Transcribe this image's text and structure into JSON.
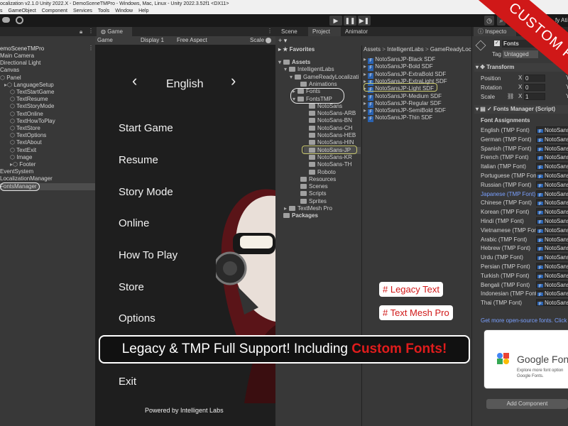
{
  "window": {
    "title": "ocalization v2.1.0 Unity 2022.X - DemoSceneTMPro - Windows, Mac, Linux - Unity 2022.3.52f1 <DX11>"
  },
  "menu": [
    "s",
    "GameObject",
    "Component",
    "Services",
    "Tools",
    "Window",
    "Help"
  ],
  "toolbar": {
    "account": "fy Ati"
  },
  "hierarchy": {
    "root": "emoSceneTMPro",
    "items": [
      {
        "label": "Main Camera"
      },
      {
        "label": "Directional Light"
      },
      {
        "label": "Canvas"
      },
      {
        "label": "Panel"
      },
      {
        "label": "LanguageSetup"
      },
      {
        "label": "TextStartGame"
      },
      {
        "label": "TextResume"
      },
      {
        "label": "TextStoryMode"
      },
      {
        "label": "TextOnline"
      },
      {
        "label": "TextHowToPlay"
      },
      {
        "label": "TextStore"
      },
      {
        "label": "TextOptions"
      },
      {
        "label": "TextAbout"
      },
      {
        "label": "TextExit"
      },
      {
        "label": "Image"
      },
      {
        "label": "Footer"
      },
      {
        "label": "EventSystem"
      },
      {
        "label": "LocalizationManager"
      },
      {
        "label": "FontsManager"
      }
    ]
  },
  "game": {
    "tab": "Game",
    "view_dropdown": "Game",
    "display": "Display 1",
    "aspect": "Free Aspect",
    "scale_label": "Scale",
    "language": "English",
    "prev": "‹",
    "next": "›",
    "menu_items": [
      "Start Game",
      "Resume",
      "Story Mode",
      "Online",
      "How To Play",
      "Store",
      "Options",
      "Exit"
    ],
    "footer": "Powered by Intelligent Labs"
  },
  "scene_tabs": {
    "scene": "Scene",
    "project": "Project",
    "animator": "Animator"
  },
  "project": {
    "favorites": "Favorites",
    "breadcrumb": [
      "Assets",
      "IntelligentLabs",
      "GameReadyLoc"
    ],
    "tree": [
      {
        "label": "Assets"
      },
      {
        "label": "IntelligentLabs"
      },
      {
        "label": "GameReadyLocalizati"
      },
      {
        "label": "Animations"
      },
      {
        "label": "Fonts"
      },
      {
        "label": "FontsTMP"
      },
      {
        "label": "NotoSans"
      },
      {
        "label": "NotoSans-ARB"
      },
      {
        "label": "NotoSans-BN"
      },
      {
        "label": "NotoSans-CH"
      },
      {
        "label": "NotoSans-HEB"
      },
      {
        "label": "NotoSans-HIN"
      },
      {
        "label": "NotoSans-JP"
      },
      {
        "label": "NotoSans-KR"
      },
      {
        "label": "NotoSans-TH"
      },
      {
        "label": "Roboto"
      },
      {
        "label": "Resources"
      },
      {
        "label": "Scenes"
      },
      {
        "label": "Scripts"
      },
      {
        "label": "Sprites"
      },
      {
        "label": "TextMesh Pro"
      },
      {
        "label": "Packages"
      }
    ],
    "files": [
      "NotoSansJP-Black SDF",
      "NotoSansJP-Bold SDF",
      "NotoSansJP-ExtraBold SDF",
      "NotoSansJP-ExtraLight SDF",
      "NotoSansJP-Light SDF",
      "NotoSansJP-Medium SDF",
      "NotoSansJP-Regular SDF",
      "NotoSansJP-SemiBold SDF",
      "NotoSansJP-Thin SDF"
    ]
  },
  "tags": {
    "legacy": "# Legacy Text",
    "tmp": "# Text Mesh Pro"
  },
  "banner": {
    "prefix": "Legacy & TMP Full Support! Including ",
    "highlight": "Custom Fonts!"
  },
  "inspector": {
    "tab": "Inspecto",
    "object_name": "Fonts",
    "tag_label": "Tag",
    "tag_value": "Untagged",
    "transform": "Transform",
    "position": "Position",
    "rotation": "Rotation",
    "scale": "Scale",
    "pos": [
      "0",
      "0"
    ],
    "rot": [
      "0",
      "0"
    ],
    "scl": [
      "1",
      "1"
    ],
    "axis_x": "X",
    "axis_y": "Y",
    "component": "Fonts Manager (Script)",
    "section": "Font Assignments",
    "fonts": [
      {
        "lang": "English (TMP Font)",
        "value": "NotoSans"
      },
      {
        "lang": "German (TMP Font)",
        "value": "NotoSans"
      },
      {
        "lang": "Spanish (TMP Font)",
        "value": "NotoSans"
      },
      {
        "lang": "French (TMP Font)",
        "value": "NotoSans"
      },
      {
        "lang": "Italian (TMP Font)",
        "value": "NotoSans"
      },
      {
        "lang": "Portuguese (TMP Font)",
        "value": "NotoSans"
      },
      {
        "lang": "Russian (TMP Font)",
        "value": "NotoSans"
      },
      {
        "lang": "Japanese (TMP Font)",
        "value": "NotoSans"
      },
      {
        "lang": "Chinese (TMP Font)",
        "value": "NotoSans"
      },
      {
        "lang": "Korean (TMP Font)",
        "value": "NotoSans"
      },
      {
        "lang": "Hindi (TMP Font)",
        "value": "NotoSans"
      },
      {
        "lang": "Vietnamese (TMP Font)",
        "value": "NotoSans"
      },
      {
        "lang": "Arabic (TMP Font)",
        "value": "NotoSans"
      },
      {
        "lang": "Hebrew (TMP Font)",
        "value": "NotoSans"
      },
      {
        "lang": "Urdu (TMP Font)",
        "value": "NotoSans"
      },
      {
        "lang": "Persian (TMP Font)",
        "value": "NotoSans"
      },
      {
        "lang": "Turkish (TMP Font)",
        "value": "NotoSans"
      },
      {
        "lang": "Bengali (TMP Font)",
        "value": "NotoSans"
      },
      {
        "lang": "Indonesian (TMP Font)",
        "value": "NotoSans"
      },
      {
        "lang": "Thai (TMP Font)",
        "value": "NotoSans"
      }
    ],
    "link": "Get more open-source fonts. Click",
    "google_title": "Google Fon",
    "google_sub1": "Explore more font option",
    "google_sub2": "Google Fonts.",
    "add_component": "Add Component"
  },
  "ribbon": "CUSTOM FO",
  "colors": {
    "accent_red": "#d01818",
    "selection_blue": "#7aa0ff",
    "panel": "#383838",
    "game_bg": "#202020"
  }
}
